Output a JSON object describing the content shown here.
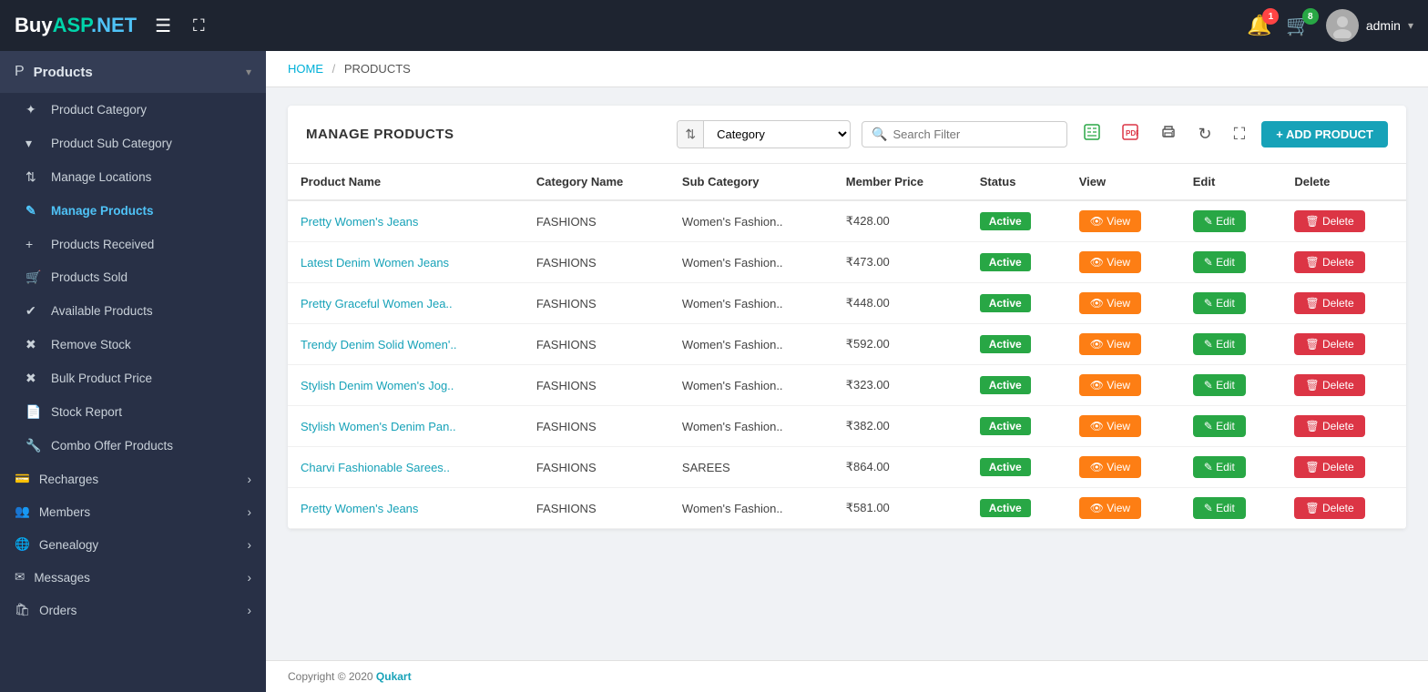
{
  "logo": {
    "buy": "Buy",
    "asp": "ASP",
    "net": ".NET"
  },
  "topnav": {
    "notification_count": "1",
    "cart_count": "8",
    "admin_label": "admin"
  },
  "sidebar": {
    "products_label": "Products",
    "items": [
      {
        "id": "product-category",
        "icon": "✦",
        "label": "Product Category"
      },
      {
        "id": "product-sub-category",
        "icon": "▾",
        "label": "Product Sub Category"
      },
      {
        "id": "manage-locations",
        "icon": "↑",
        "label": "Manage Locations"
      },
      {
        "id": "manage-products",
        "icon": "✎",
        "label": "Manage Products",
        "active": true
      },
      {
        "id": "products-received",
        "icon": "+",
        "label": "Products Received"
      },
      {
        "id": "products-sold",
        "icon": "🛒",
        "label": "Products Sold"
      },
      {
        "id": "available-products",
        "icon": "✔",
        "label": "Available Products"
      },
      {
        "id": "remove-stock",
        "icon": "✖",
        "label": "Remove Stock"
      },
      {
        "id": "bulk-product-price",
        "icon": "✖",
        "label": "Bulk Product Price"
      },
      {
        "id": "stock-report",
        "icon": "📄",
        "label": "Stock Report"
      },
      {
        "id": "combo-offer-products",
        "icon": "🔧",
        "label": "Combo Offer Products"
      }
    ],
    "groups": [
      {
        "id": "recharges",
        "label": "Recharges"
      },
      {
        "id": "members",
        "label": "Members"
      },
      {
        "id": "genealogy",
        "label": "Genealogy"
      },
      {
        "id": "messages",
        "label": "Messages"
      },
      {
        "id": "orders",
        "label": "Orders"
      }
    ]
  },
  "breadcrumb": {
    "home": "HOME",
    "separator": "/",
    "current": "PRODUCTS"
  },
  "toolbar": {
    "title": "MANAGE PRODUCTS",
    "category_placeholder": "Category",
    "search_placeholder": "Search Filter",
    "add_button": "+ ADD PRODUCT"
  },
  "table": {
    "headers": [
      "Product Name",
      "Category Name",
      "Sub Category",
      "Member Price",
      "Status",
      "View",
      "Edit",
      "Delete"
    ],
    "rows": [
      {
        "name": "Pretty Women's Jeans",
        "category": "FASHIONS",
        "sub_category": "Women's Fashion..",
        "price": "₹428.00",
        "status": "Active"
      },
      {
        "name": "Latest Denim Women Jeans",
        "category": "FASHIONS",
        "sub_category": "Women's Fashion..",
        "price": "₹473.00",
        "status": "Active"
      },
      {
        "name": "Pretty Graceful Women Jea..",
        "category": "FASHIONS",
        "sub_category": "Women's Fashion..",
        "price": "₹448.00",
        "status": "Active"
      },
      {
        "name": "Trendy Denim Solid Women'..",
        "category": "FASHIONS",
        "sub_category": "Women's Fashion..",
        "price": "₹592.00",
        "status": "Active"
      },
      {
        "name": "Stylish Denim Women's Jog..",
        "category": "FASHIONS",
        "sub_category": "Women's Fashion..",
        "price": "₹323.00",
        "status": "Active"
      },
      {
        "name": "Stylish Women's Denim Pan..",
        "category": "FASHIONS",
        "sub_category": "Women's Fashion..",
        "price": "₹382.00",
        "status": "Active"
      },
      {
        "name": "Charvi Fashionable Sarees..",
        "category": "FASHIONS",
        "sub_category": "SAREES",
        "price": "₹864.00",
        "status": "Active"
      },
      {
        "name": "Pretty Women's Jeans",
        "category": "FASHIONS",
        "sub_category": "Women's Fashion..",
        "price": "₹581.00",
        "status": "Active"
      }
    ],
    "btn_view": "View",
    "btn_edit": "Edit",
    "btn_delete": "Delete",
    "status_active": "Active"
  },
  "footer": {
    "text": "Copyright © 2020",
    "brand": "Qukart"
  }
}
